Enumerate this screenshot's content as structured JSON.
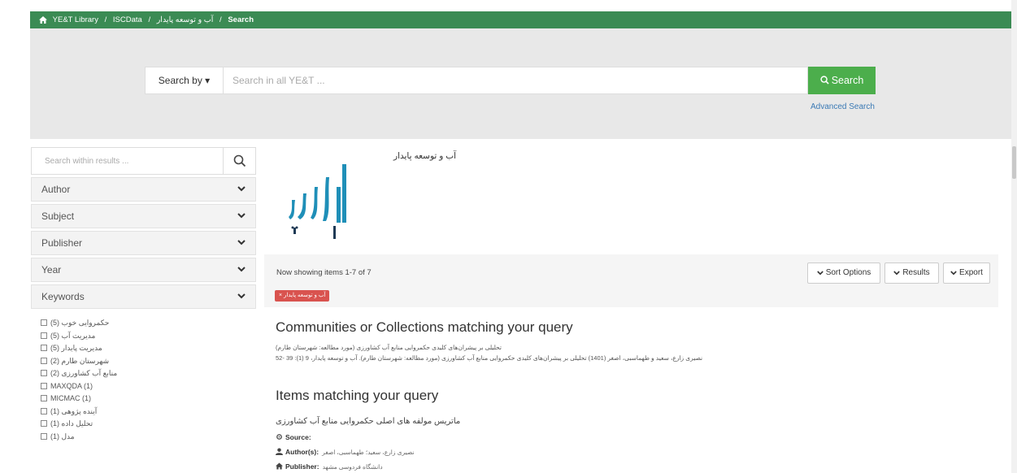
{
  "breadcrumb": {
    "home": "YE&T Library",
    "items": [
      "ISCData",
      "آب و توسعه پایدار"
    ],
    "current": "Search",
    "separator": "/"
  },
  "search": {
    "search_by_label": "Search by ▾",
    "placeholder": "Search in all YE&T ...",
    "button_label": "Search",
    "advanced_label": "Advanced Search"
  },
  "sidebar": {
    "within_placeholder": "Search within results ...",
    "facets": [
      "Author",
      "Subject",
      "Publisher",
      "Year",
      "Keywords"
    ],
    "keywords": [
      "حکمروایی خوب (5)",
      "مدیریت آب (5)",
      "مدیریت پایدار (5)",
      "شهرستان طارم (2)",
      "منابع آب کشاورزی (2)",
      "MAXQDA (1)",
      "MICMAC (1)",
      "آینده پژوهی (1)",
      "تحلیل داده (1)",
      "مدل (1)"
    ]
  },
  "collection": {
    "title": "آب و توسعه پایدار",
    "logo_icon": "collection-logo"
  },
  "results": {
    "showing": "Now showing items 1-7 of 7",
    "filter_tag": "× آب و توسعه پایدار",
    "sort_label": "Sort Options",
    "results_label": "Results",
    "export_label": "Export"
  },
  "communities": {
    "heading": "Communities or Collections matching your query",
    "line1": "تحلیلی بر پیشران‌های کلیدی حکمروایی منابع آب کشاورزی (مورد مطالعه: شهرستان طارم)",
    "line2": "نصیری زارع، سعید و طهماسبی، اصغر (1401) تحلیلی بر پیشران‌های کلیدی حکمروایی منابع آب کشاورزی (مورد مطالعه: شهرستان طارم). آب و توسعه پایدار، 9 (1): 39 -52"
  },
  "items": {
    "heading": "Items matching your query",
    "first_title": "ماتریس مولفه های اصلی حکمروایی منابع آب کشاورزی",
    "source_label": "Source:",
    "authors_label": "Author(s):",
    "authors_value": "نصیری زارع، سعید؛ طهماسبی، اصغر",
    "publisher_label": "Publisher:",
    "publisher_value": "دانشگاه فردوسی مشهد"
  },
  "colors": {
    "topbar": "#3b8b54",
    "search_button": "#4cae4c",
    "filter_tag": "#d9534f",
    "link": "#3b7ab5"
  }
}
